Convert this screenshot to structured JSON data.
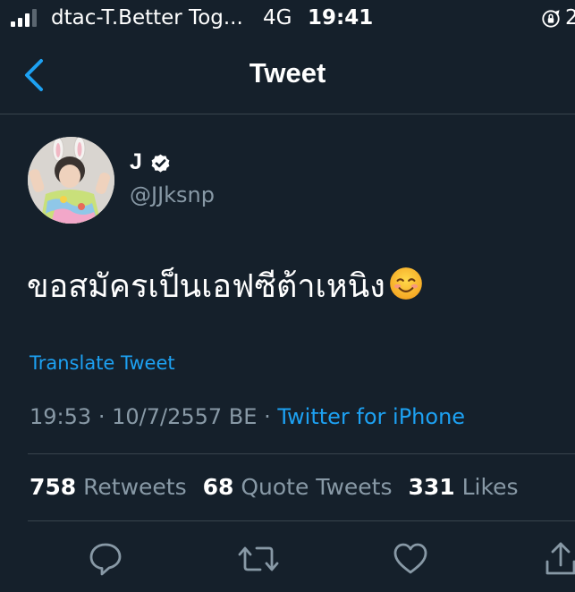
{
  "status_bar": {
    "carrier": "dtac-T.Better Tog...",
    "network": "4G",
    "time": "19:41",
    "battery_partial": "2"
  },
  "nav": {
    "title": "Tweet",
    "back_icon": "chevron-left-icon"
  },
  "tweet": {
    "author": {
      "display_name": "J",
      "handle": "@JJksnp",
      "verified": true
    },
    "text": "ขอสมัครเป็นเอฟซีต้าเหนิง",
    "emoji": "smiling-face-icon",
    "translate_label": "Translate Tweet",
    "time": "19:53",
    "separator": "·",
    "date": "10/7/2557 BE",
    "source": "Twitter for iPhone"
  },
  "stats": {
    "retweets": {
      "count": "758",
      "label": "Retweets"
    },
    "quote_tweets": {
      "count": "68",
      "label": "Quote Tweets"
    },
    "likes": {
      "count": "331",
      "label": "Likes"
    }
  },
  "actions": [
    "reply-icon",
    "retweet-icon",
    "like-icon",
    "share-icon"
  ],
  "colors": {
    "background": "#15202b",
    "accent": "#1da1f2",
    "secondary_text": "#8899a6",
    "divider": "#38444d"
  }
}
